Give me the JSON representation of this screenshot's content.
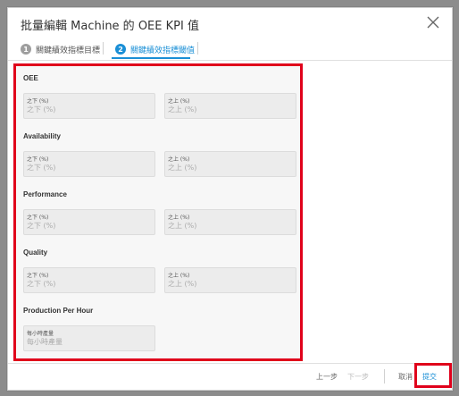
{
  "dialog": {
    "title": "批量編輯 Machine 的 OEE KPI 值",
    "close_icon": "close-icon"
  },
  "steps": [
    {
      "number": "1",
      "label": "關鍵績效指標目標"
    },
    {
      "number": "2",
      "label": "關鍵績效指標閾值"
    }
  ],
  "sections": [
    {
      "title": "OEE",
      "fields": [
        {
          "label": "之下 (%)",
          "placeholder": "之下 (%)"
        },
        {
          "label": "之上 (%)",
          "placeholder": "之上 (%)"
        }
      ]
    },
    {
      "title": "Availability",
      "fields": [
        {
          "label": "之下 (%)",
          "placeholder": "之下 (%)"
        },
        {
          "label": "之上 (%)",
          "placeholder": "之上 (%)"
        }
      ]
    },
    {
      "title": "Performance",
      "fields": [
        {
          "label": "之下 (%)",
          "placeholder": "之下 (%)"
        },
        {
          "label": "之上 (%)",
          "placeholder": "之上 (%)"
        }
      ]
    },
    {
      "title": "Quality",
      "fields": [
        {
          "label": "之下 (%)",
          "placeholder": "之下 (%)"
        },
        {
          "label": "之上 (%)",
          "placeholder": "之上 (%)"
        }
      ]
    },
    {
      "title": "Production Per Hour",
      "fields": [
        {
          "label": "每小時產量",
          "placeholder": "每小時產量"
        }
      ]
    }
  ],
  "footer": {
    "prev": "上一步",
    "next": "下一步",
    "cancel": "取消",
    "submit": "提交"
  },
  "colors": {
    "accent": "#1a8fd6",
    "highlight": "#e0001b"
  }
}
